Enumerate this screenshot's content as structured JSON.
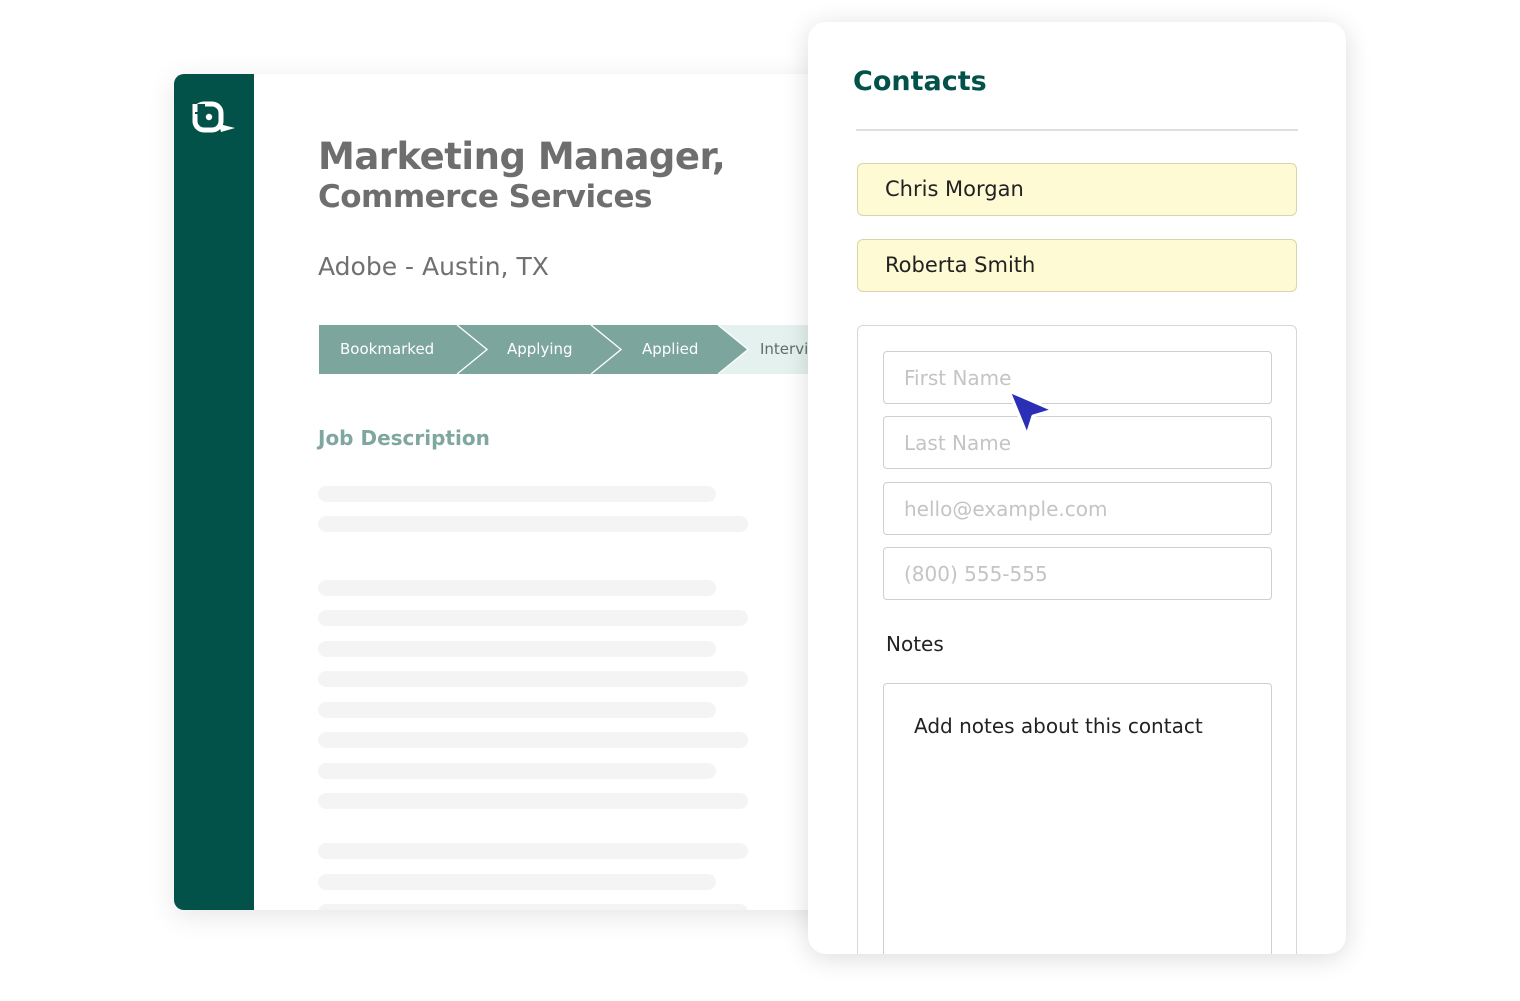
{
  "job": {
    "title_line1": "Marketing Manager,",
    "title_line2": "Commerce Services",
    "company_location": "Adobe - Austin, TX",
    "pipeline": [
      {
        "label": "Bookmarked",
        "state": "done"
      },
      {
        "label": "Applying",
        "state": "done"
      },
      {
        "label": "Applied",
        "state": "done"
      },
      {
        "label": "Intervi",
        "state": "pending"
      }
    ],
    "section_title": "Job Description"
  },
  "contacts": {
    "title": "Contacts",
    "existing": [
      {
        "name": "Chris Morgan"
      },
      {
        "name": "Roberta Smith"
      }
    ],
    "form": {
      "first_name_placeholder": "First Name",
      "last_name_placeholder": "Last Name",
      "email_placeholder": "hello@example.com",
      "phone_placeholder": "(800) 555-555",
      "notes_label": "Notes",
      "notes_placeholder": "Add notes about this contact"
    }
  },
  "colors": {
    "brand_dark_green": "#03524a",
    "pipeline_done": "#7ba59d",
    "pipeline_pending": "#e4f1ee",
    "contact_chip": "#fefad4",
    "cursor": "#2a2fb5"
  },
  "icons": {
    "logo": "app-logo-icon",
    "cursor": "mouse-pointer-icon"
  }
}
